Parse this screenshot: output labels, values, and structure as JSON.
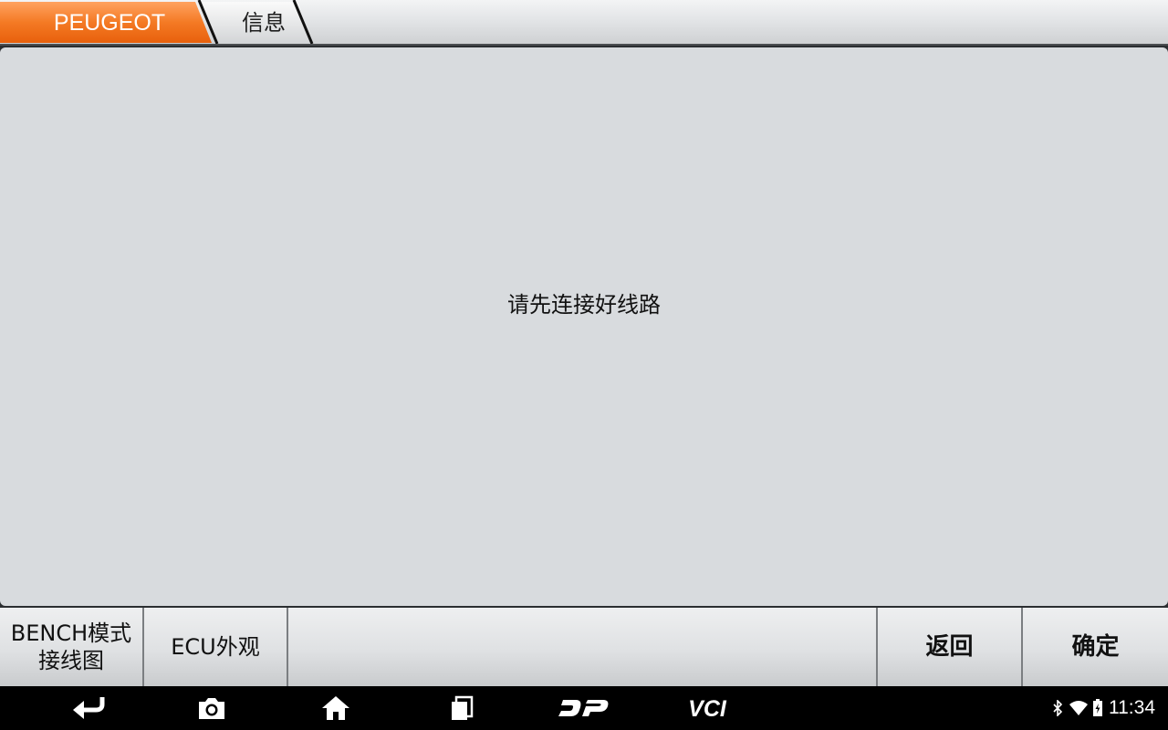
{
  "breadcrumb": {
    "brand": "PEUGEOT",
    "page": "信息",
    "brand_color": "#f36f19"
  },
  "content": {
    "message": "请先连接好线路"
  },
  "buttons": {
    "bench_line1": "BENCH模式",
    "bench_line2": "接线图",
    "ecu": "ECU外观",
    "back": "返回",
    "ok": "确定"
  },
  "navbar": {
    "icons": [
      "back-icon",
      "camera-icon",
      "home-icon",
      "recents-icon",
      "dp-icon",
      "vci-icon"
    ],
    "dp_label": "DP",
    "vci_label": "VCI"
  },
  "status": {
    "icons": [
      "bluetooth-icon",
      "wifi-icon",
      "battery-icon"
    ],
    "time": "11:34"
  }
}
